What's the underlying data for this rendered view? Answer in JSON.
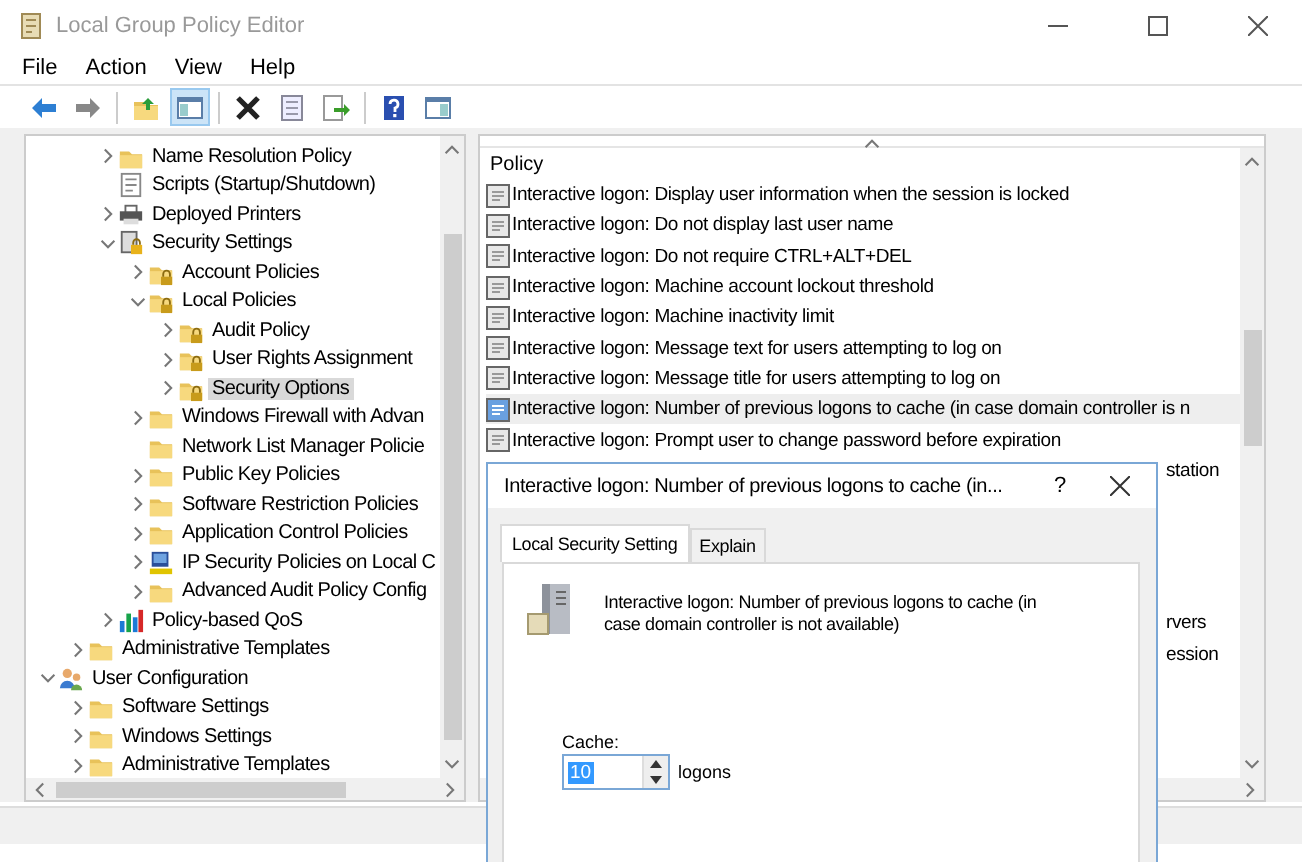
{
  "window": {
    "title": "Local Group Policy Editor"
  },
  "menu": [
    "File",
    "Action",
    "View",
    "Help"
  ],
  "toolbar": [
    {
      "kind": "back",
      "pressed": false
    },
    {
      "kind": "forward",
      "pressed": false
    },
    {
      "kind": "sep"
    },
    {
      "kind": "up",
      "pressed": false
    },
    {
      "kind": "tree",
      "pressed": true
    },
    {
      "kind": "sep"
    },
    {
      "kind": "delete",
      "pressed": false
    },
    {
      "kind": "properties",
      "pressed": false
    },
    {
      "kind": "export",
      "pressed": false
    },
    {
      "kind": "sep"
    },
    {
      "kind": "help",
      "pressed": false
    },
    {
      "kind": "pane",
      "pressed": false
    }
  ],
  "tree": [
    {
      "children": [
        {
          "children": [
            {
              "label": "Name Resolution Policy",
              "kind": "folder",
              "expanded": false,
              "selected": false
            },
            {
              "label": "Scripts (Startup/Shutdown)",
              "kind": "scripts",
              "selected": false
            },
            {
              "label": "Deployed Printers",
              "kind": "printer",
              "expanded": false,
              "selected": false
            },
            {
              "label": "Security Settings",
              "kind": "security",
              "expanded": true,
              "selected": false,
              "children": [
                {
                  "label": "Account Policies",
                  "kind": "lockfolder",
                  "expanded": false,
                  "selected": false
                },
                {
                  "label": "Local Policies",
                  "kind": "lockfolder",
                  "expanded": true,
                  "selected": false,
                  "children": [
                    {
                      "label": "Audit Policy",
                      "kind": "lockfolder",
                      "expanded": false,
                      "selected": false
                    },
                    {
                      "label": "User Rights Assignment",
                      "kind": "lockfolder",
                      "expanded": false,
                      "selected": false
                    },
                    {
                      "label": "Security Options",
                      "kind": "lockfolder",
                      "expanded": false,
                      "selected": true
                    }
                  ]
                },
                {
                  "label": "Windows Firewall with Advan",
                  "kind": "folder",
                  "expanded": false,
                  "selected": false
                },
                {
                  "label": "Network List Manager Policie",
                  "kind": "folder",
                  "selected": false
                },
                {
                  "label": "Public Key Policies",
                  "kind": "folder",
                  "expanded": false,
                  "selected": false
                },
                {
                  "label": "Software Restriction Policies",
                  "kind": "folder",
                  "expanded": false,
                  "selected": false
                },
                {
                  "label": "Application Control Policies",
                  "kind": "folder",
                  "expanded": false,
                  "selected": false
                },
                {
                  "label": "IP Security Policies on Local C",
                  "kind": "ipsec",
                  "expanded": false,
                  "selected": false
                },
                {
                  "label": "Advanced Audit Policy Config",
                  "kind": "folder",
                  "expanded": false,
                  "selected": false
                }
              ]
            },
            {
              "label": "Policy-based QoS",
              "kind": "qos",
              "expanded": false,
              "selected": false
            }
          ]
        },
        {
          "label": "Administrative Templates",
          "kind": "folder",
          "expanded": false,
          "selected": false
        }
      ]
    },
    {
      "label": "User Configuration",
      "kind": "user",
      "expanded": true,
      "selected": false,
      "children": [
        {
          "label": "Software Settings",
          "kind": "folder",
          "expanded": false,
          "selected": false
        },
        {
          "label": "Windows Settings",
          "kind": "folder",
          "expanded": false,
          "selected": false
        },
        {
          "label": "Administrative Templates",
          "kind": "folder",
          "expanded": false,
          "selected": false
        }
      ]
    }
  ],
  "list": {
    "column": "Policy",
    "rows": [
      {
        "kind": "full",
        "text": "Interactive logon: Display user information when the session is locked",
        "selected": false
      },
      {
        "kind": "full",
        "text": "Interactive logon: Do not display last user name",
        "selected": false
      },
      {
        "kind": "full",
        "text": "Interactive logon: Do not require CTRL+ALT+DEL",
        "selected": false
      },
      {
        "kind": "full",
        "text": "Interactive logon: Machine account lockout threshold",
        "selected": false
      },
      {
        "kind": "full",
        "text": "Interactive logon: Machine inactivity limit",
        "selected": false
      },
      {
        "kind": "full",
        "text": "Interactive logon: Message text for users attempting to log on",
        "selected": false
      },
      {
        "kind": "full",
        "text": "Interactive logon: Message title for users attempting to log on",
        "selected": false
      },
      {
        "kind": "full",
        "text": "Interactive logon: Number of previous logons to cache (in case domain controller is n",
        "selected": true
      },
      {
        "kind": "full",
        "text": "Interactive logon: Prompt user to change password before expiration",
        "selected": false
      },
      {
        "kind": "partial",
        "text": "station",
        "selected": false
      },
      {
        "kind": "covered"
      },
      {
        "kind": "covered"
      },
      {
        "kind": "covered"
      },
      {
        "kind": "covered"
      },
      {
        "kind": "partial",
        "text": "rvers",
        "selected": false
      },
      {
        "kind": "partial",
        "text": "ession",
        "selected": false
      }
    ]
  },
  "dialog": {
    "title": "Interactive logon: Number of previous logons to cache (in...",
    "help": "?",
    "tabs": [
      {
        "label": "Local Security Setting",
        "selected": true
      },
      {
        "label": "Explain",
        "selected": false
      }
    ],
    "description": "Interactive logon: Number of previous logons to cache (in case domain controller is not available)",
    "field_label": "Cache:",
    "value": "10",
    "unit": "logons"
  }
}
